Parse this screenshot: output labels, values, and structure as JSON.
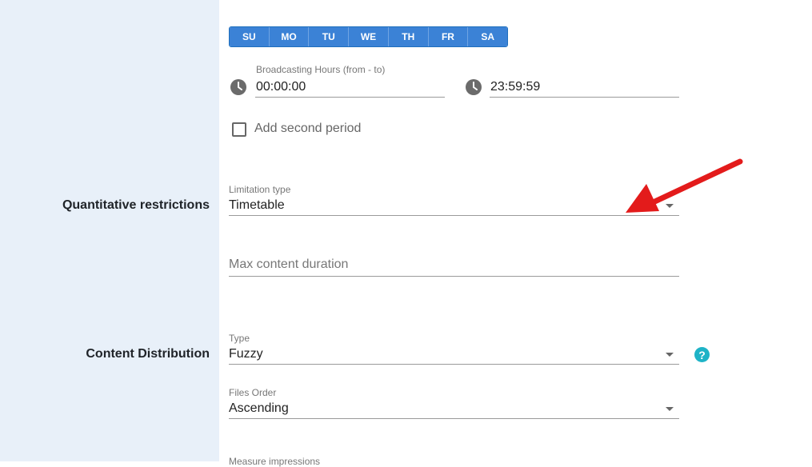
{
  "days": [
    "SU",
    "MO",
    "TU",
    "WE",
    "TH",
    "FR",
    "SA"
  ],
  "broadcasting": {
    "label": "Broadcasting Hours (from - to)",
    "from": "00:00:00",
    "to": "23:59:59"
  },
  "add_second_period": "Add second period",
  "quantitative": {
    "section_label": "Quantitative restrictions",
    "limitation_label": "Limitation type",
    "limitation_value": "Timetable",
    "max_duration_placeholder": "Max content duration"
  },
  "distribution": {
    "section_label": "Content Distribution",
    "type_label": "Type",
    "type_value": "Fuzzy",
    "files_order_label": "Files Order",
    "files_order_value": "Ascending",
    "measure_label": "Measure impressions"
  },
  "colors": {
    "accent": "#3b82d6",
    "help": "#1eb3c7",
    "annotation_arrow": "#e31b1b",
    "sidebar": "#e8f0f9"
  }
}
